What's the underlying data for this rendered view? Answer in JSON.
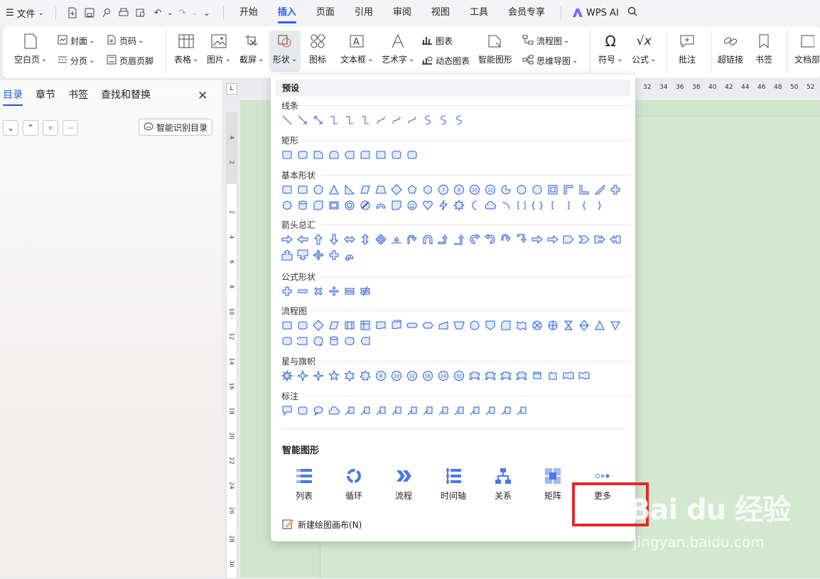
{
  "menubar": {
    "file_label": "文件",
    "tabs": [
      "开始",
      "插入",
      "页面",
      "引用",
      "审阅",
      "视图",
      "工具",
      "会员专享"
    ],
    "active_tab": "插入",
    "wps_ai_label": "WPS AI"
  },
  "ribbon": {
    "blank_page": "空白页",
    "cover": "封面",
    "page_break": "分页",
    "page_number": "页码",
    "header_footer": "页眉页脚",
    "table": "表格",
    "picture": "图片",
    "screenshot": "截屏",
    "shapes": "形状",
    "icons": "图标",
    "textbox": "文本框",
    "wordart": "艺术字",
    "chart": "图表",
    "dynamic_chart": "动态图表",
    "smart_graphic": "智能图形",
    "flowchart": "流程图",
    "mindmap": "思维导图",
    "symbol": "符号",
    "formula": "公式",
    "comment": "批注",
    "hyperlink": "超链接",
    "bookmark": "书签",
    "doc_parts": "文档部"
  },
  "nav": {
    "tabs": [
      "目录",
      "章节",
      "书签",
      "查找和替换"
    ],
    "active_tab": "目录",
    "smart_toc": "智能识别目录"
  },
  "ruler": {
    "h_numbers": [
      "32",
      "34",
      "36",
      "38",
      "40",
      "42",
      "44",
      "46",
      "48",
      "50",
      "52"
    ],
    "v_numbers": [
      "4",
      "2",
      "2",
      "4",
      "6",
      "8",
      "10",
      "12",
      "14",
      "16",
      "18",
      "20",
      "22",
      "24",
      "26",
      "28",
      "30"
    ]
  },
  "shapes_panel": {
    "preset_title": "预设",
    "categories": [
      "线条",
      "矩形",
      "基本形状",
      "箭头总汇",
      "公式形状",
      "流程图",
      "星与旗帜",
      "标注"
    ],
    "smart_title": "智能图形",
    "smart_items": [
      "列表",
      "循环",
      "流程",
      "时间轴",
      "关系",
      "矩阵",
      "更多"
    ],
    "new_canvas": "新建绘图画布(N)"
  },
  "watermark": {
    "main": "Bai du 经验",
    "sub": "jingyan.baidu.com"
  },
  "colors": {
    "accent": "#2a62ff",
    "shape_stroke": "#2d5bd6",
    "shape_fill": "#e3ecff",
    "highlight": "#e8262a",
    "doc_bg": "#cfe6cc"
  }
}
